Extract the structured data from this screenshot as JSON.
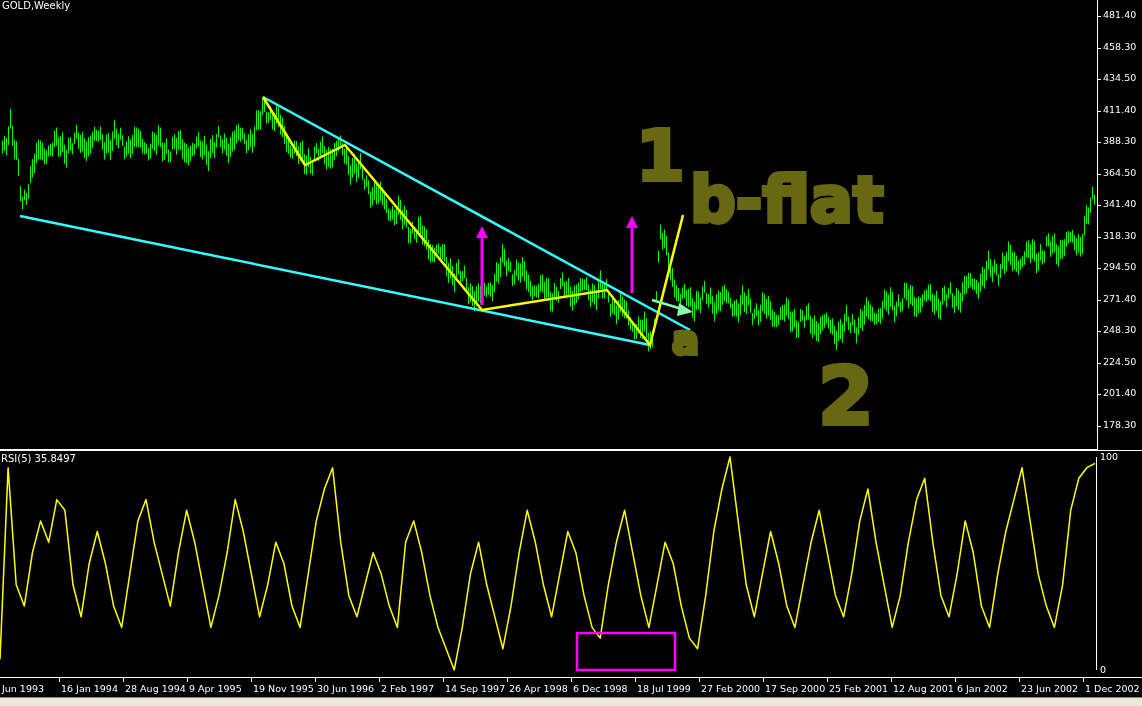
{
  "price_chart": {
    "title": "GOLD,Weekly",
    "y_ticks": [
      "481.40",
      "458.30",
      "434.50",
      "411.40",
      "388.30",
      "364.50",
      "341.40",
      "318.30",
      "294.50",
      "271.40",
      "248.30",
      "224.50",
      "201.40",
      "178.30"
    ],
    "annotations": [
      {
        "text": "1"
      },
      {
        "text": "b-flat"
      },
      {
        "text": "a"
      },
      {
        "text": "2"
      }
    ]
  },
  "rsi_panel": {
    "label": "RSI(5) 35.8497",
    "chart_data": {
      "type": "line",
      "ylim": [
        0,
        100
      ],
      "yticks": [
        {
          "value": 0,
          "label": "0"
        },
        {
          "value": 100,
          "label": "100"
        }
      ],
      "series": [
        {
          "color": "#ffff00",
          "values": [
            5,
            95,
            40,
            30,
            55,
            70,
            60,
            80,
            75,
            40,
            25,
            50,
            65,
            50,
            30,
            20,
            45,
            70,
            80,
            60,
            45,
            30,
            55,
            75,
            60,
            40,
            20,
            35,
            55,
            80,
            65,
            45,
            25,
            40,
            60,
            50,
            30,
            20,
            45,
            70,
            85,
            95,
            60,
            35,
            25,
            40,
            55,
            45,
            30,
            20,
            60,
            70,
            55,
            35,
            20,
            10,
            0,
            20,
            45,
            60,
            40,
            25,
            10,
            30,
            55,
            75,
            60,
            40,
            25,
            45,
            65,
            55,
            35,
            20,
            15,
            40,
            60,
            75,
            55,
            35,
            20,
            40,
            60,
            50,
            30,
            15,
            10,
            35,
            65,
            85,
            100,
            70,
            40,
            25,
            45,
            65,
            50,
            30,
            20,
            40,
            60,
            75,
            55,
            35,
            25,
            45,
            70,
            85,
            60,
            40,
            20,
            35,
            60,
            80,
            90,
            60,
            35,
            25,
            45,
            70,
            55,
            30,
            20,
            45,
            65,
            80,
            95,
            70,
            45,
            30,
            20,
            40,
            75,
            90,
            95,
            97
          ]
        }
      ]
    }
  },
  "x_axis": {
    "labels": [
      "Jun 1993",
      "16 Jan 1994",
      "28 Aug 1994",
      "9 Apr 1995",
      "19 Nov 1995",
      "30 Jun 1996",
      "2 Feb 1997",
      "14 Sep 1997",
      "26 Apr 1998",
      "6 Dec 1998",
      "18 Jul 1999",
      "27 Feb 2000",
      "17 Sep 2000",
      "25 Feb 2001",
      "12 Aug 2001",
      "6 Jan 2002",
      "23 Jun 2002",
      "1 Dec 2002"
    ]
  }
}
